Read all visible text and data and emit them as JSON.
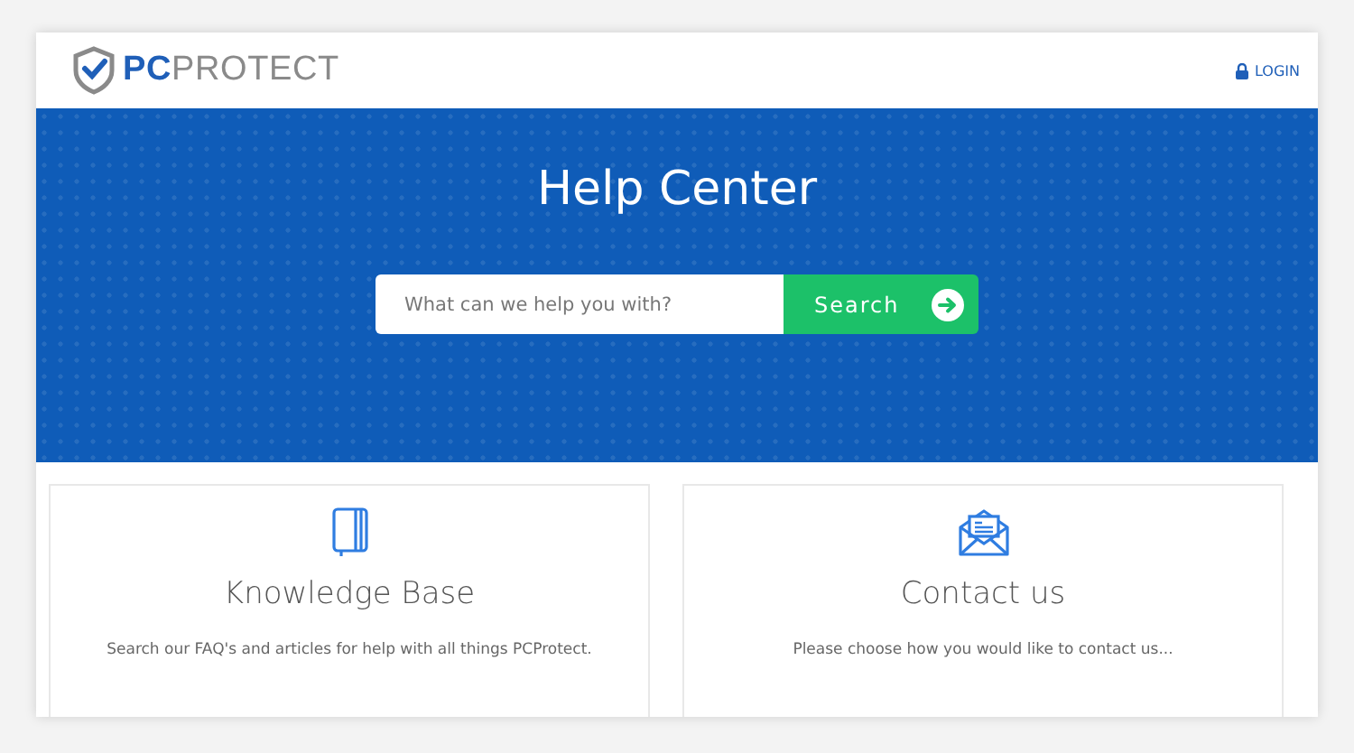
{
  "header": {
    "logo": "**PC**PROTECT",
    "login": "LOGIN"
  },
  "hero": {
    "title": "Help Center",
    "search": {
      "placeholder": "What can we help you with?",
      "button": "Search"
    }
  },
  "cards": [
    {
      "title": "Knowledge Base",
      "description": "Search our FAQ's and articles for help with all things PCProtect."
    },
    {
      "title": "Contact us",
      "description": "Please choose how you would like to contact us..."
    }
  ]
}
